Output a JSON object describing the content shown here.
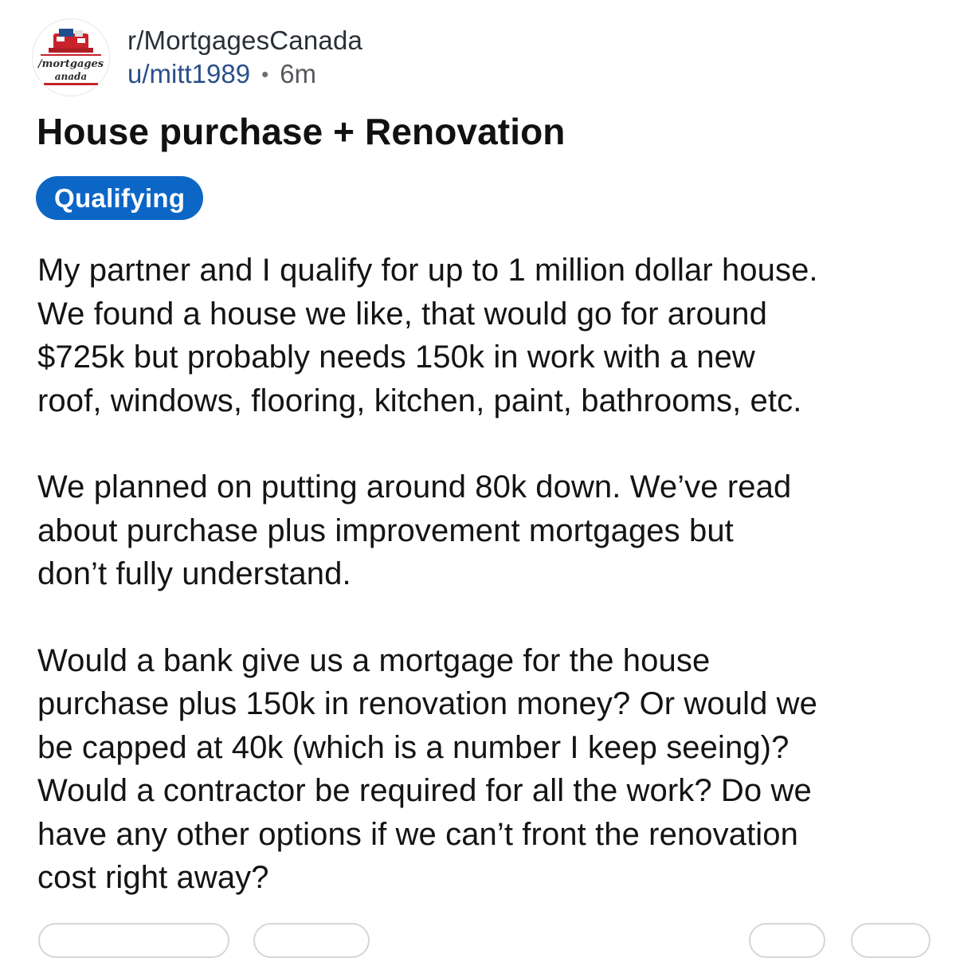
{
  "post": {
    "subreddit": "r/MortgagesCanada",
    "author": "u/mitt1989",
    "separator": "•",
    "age": "6m",
    "title": "House purchase + Renovation",
    "flair": "Qualifying",
    "avatar": {
      "line1": "/mortgages",
      "line2": "anada"
    },
    "body": {
      "p1": [
        "My partner and I qualify for up to 1 million dollar house.",
        "We found a house we like, that would go for around",
        "$725k but probably needs 150k in work with a new",
        "roof, windows, flooring, kitchen, paint, bathrooms, etc."
      ],
      "p2": [
        "We planned on putting around 80k down. We’ve read",
        "about purchase plus improvement mortgages but",
        "don’t fully understand."
      ],
      "p3": [
        "Would a bank give us a mortgage for the house",
        "purchase plus 150k in renovation money? Or would we",
        "be capped at 40k (which is a number I keep seeing)?",
        "Would a contractor be required for all the work? Do we",
        "have any other options if we can’t front the renovation",
        "cost right away?"
      ]
    }
  },
  "colors": {
    "flair_bg": "#0b66c6",
    "author_link": "#2b4f8a",
    "text": "#141414"
  },
  "icons": {
    "avatar": "subreddit-avatar-icon"
  }
}
